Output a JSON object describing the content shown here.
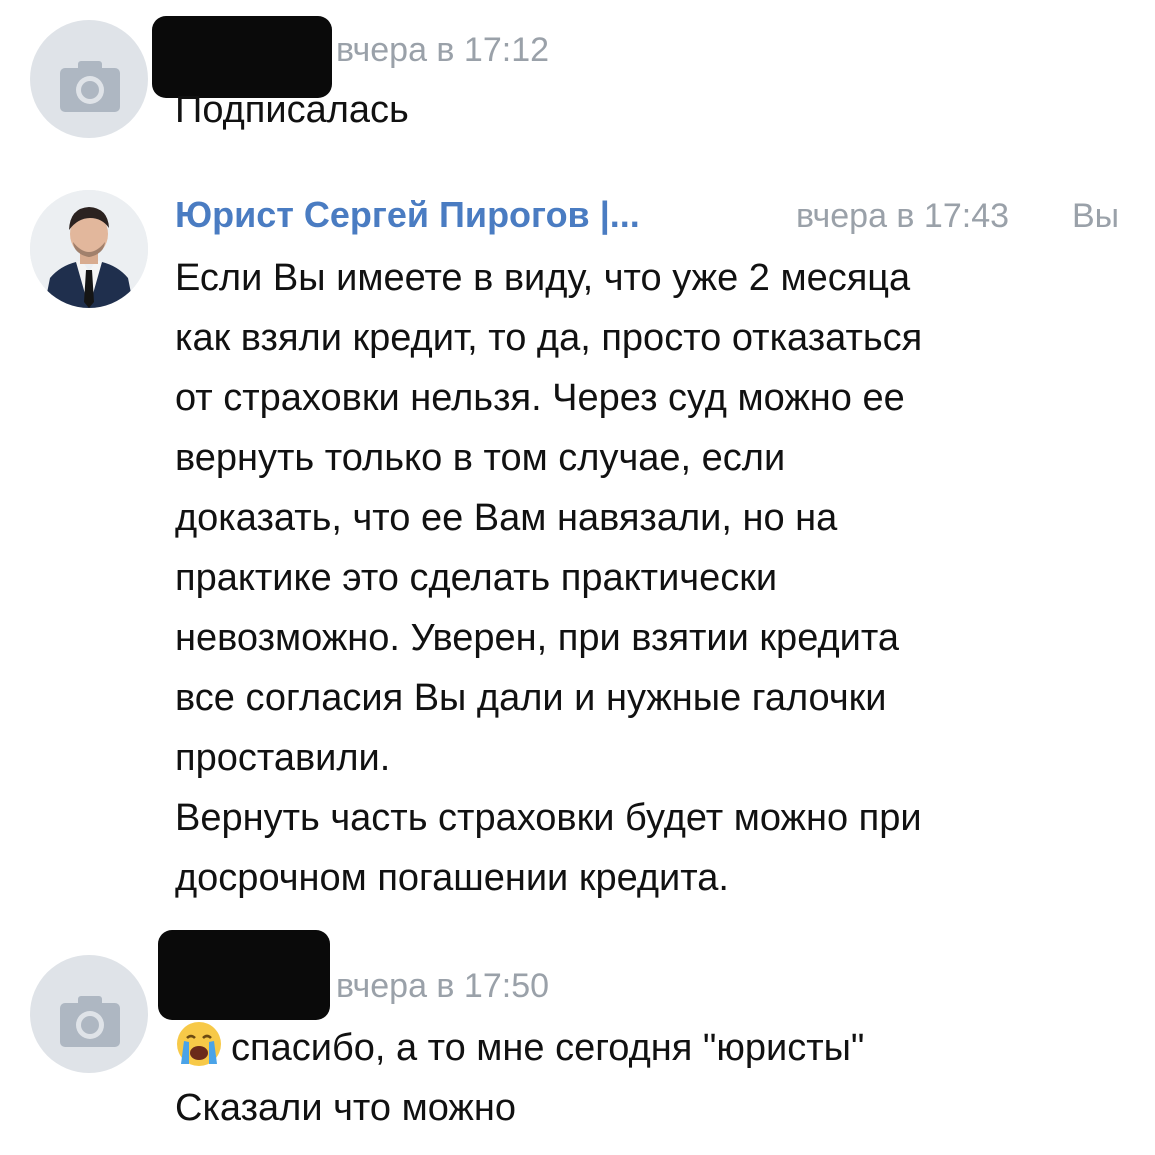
{
  "messages": [
    {
      "time": "вчера в 17:12",
      "text_lines": [
        "Подписалась"
      ]
    },
    {
      "author": "Юрист Сергей Пирогов |...",
      "time": "вчера в 17:43",
      "you_label": "Вы",
      "text_lines": [
        "Если Вы имеете в виду, что уже 2 месяца",
        "как взяли кредит, то да, просто отказаться",
        "от страховки нельзя. Через суд можно ее",
        "вернуть только в том случае, если",
        "доказать, что ее Вам навязали, но на",
        "практике это сделать практически",
        "невозможно. Уверен, при взятии кредита",
        "все согласия Вы дали и нужные галочки",
        "проставили.",
        "Вернуть часть страховки будет можно при",
        "досрочном погашении кредита."
      ]
    },
    {
      "time": "вчера в 17:50",
      "emoji": "crying-face-emoji",
      "text_lines": [
        "спасибо, а то мне сегодня \"юристы\"",
        "Сказали что можно"
      ]
    }
  ],
  "colors": {
    "author_link": "#4a7cc2",
    "meta_gray": "#9aa1a9",
    "avatar_placeholder": "#dfe3e8",
    "camera_icon": "#aeb7c2"
  }
}
